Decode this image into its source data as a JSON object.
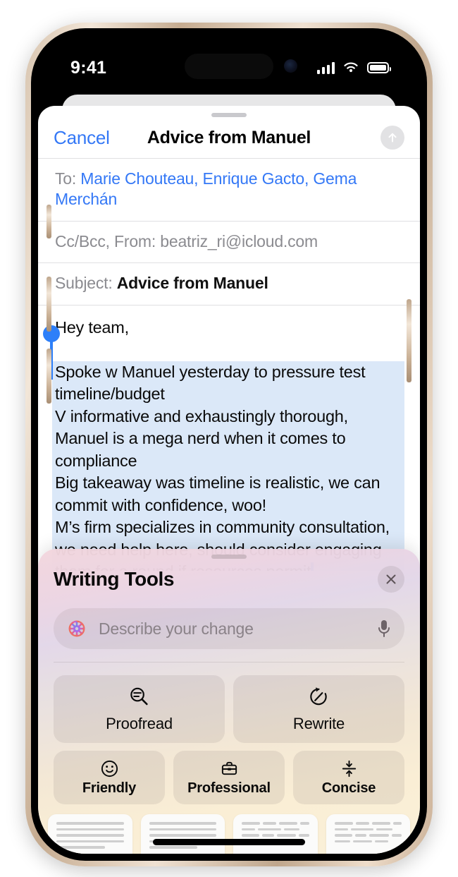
{
  "status_bar": {
    "time": "9:41",
    "signal_icon": "cellular-bars-icon",
    "wifi_icon": "wifi-icon",
    "battery_icon": "battery-full-icon"
  },
  "compose": {
    "cancel_label": "Cancel",
    "title": "Advice from Manuel",
    "send_icon": "arrow-up-icon",
    "fields": {
      "to_label": "To:",
      "to_value": "Marie Chouteau, Enrique Gacto, Gema Merchán",
      "ccbcc_label": "Cc/Bcc, From:",
      "ccbcc_value": "beatriz_ri@icloud.com",
      "subject_label": "Subject:",
      "subject_value": "Advice from Manuel"
    },
    "body": {
      "greeting": "Hey team,",
      "selected_lines": [
        "Spoke w Manuel yesterday to pressure test",
        "timeline/budget",
        "V informative and exhaustingly thorough,",
        "Manuel is a mega nerd when it comes to",
        "compliance",
        "Big takeaway was timeline is realistic, we can",
        "commit with confidence, woo!",
        "M’s firm specializes in community consultation,",
        "we need help here, should consider engaging",
        "them for a round if resources permit"
      ]
    }
  },
  "writing_tools": {
    "title": "Writing Tools",
    "close_icon": "close-icon",
    "grabber_icon": "drag-handle-icon",
    "input": {
      "placeholder": "Describe your change",
      "leading_icon": "apple-intelligence-icon",
      "mic_icon": "microphone-icon"
    },
    "primary_actions": [
      {
        "label": "Proofread",
        "icon": "magnifier-lines-icon"
      },
      {
        "label": "Rewrite",
        "icon": "rotate-pencil-icon"
      }
    ],
    "tone_actions": [
      {
        "label": "Friendly",
        "icon": "smiley-face-icon"
      },
      {
        "label": "Professional",
        "icon": "briefcase-icon"
      },
      {
        "label": "Concise",
        "icon": "compress-arrows-icon"
      }
    ],
    "document_cards": [
      {
        "style": "lines",
        "arrow": true
      },
      {
        "style": "lines",
        "arrow": false
      },
      {
        "style": "words",
        "arrow": false
      },
      {
        "style": "words",
        "arrow": true
      }
    ]
  },
  "colors": {
    "accent_blue": "#3478f6",
    "selection_blue": "#dbe8f8",
    "handle_blue": "#2d7ff9",
    "panel_top": "#f2d6dd",
    "panel_bottom": "#faf0d8"
  }
}
